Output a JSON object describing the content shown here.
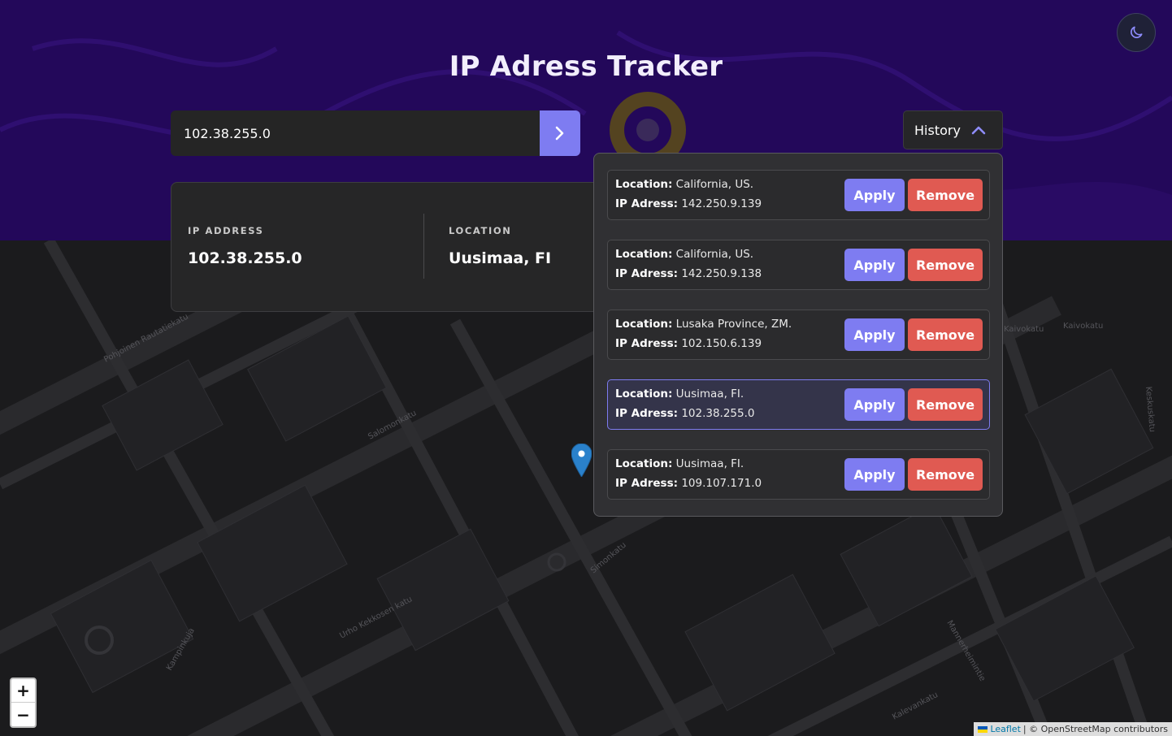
{
  "app": {
    "title": "IP Adress Tracker"
  },
  "search": {
    "value": "102.38.255.0"
  },
  "history_toggle": {
    "label": "History"
  },
  "info": {
    "ip_heading": "IP ADDRESS",
    "ip_value": "102.38.255.0",
    "location_heading": "LOCATION",
    "location_value": "Uusimaa, FI"
  },
  "history": {
    "location_label": "Location:",
    "ip_label": "IP Adress:",
    "apply_label": "Apply",
    "remove_label": "Remove",
    "entries": [
      {
        "location": "California, US.",
        "ip": "142.250.9.139",
        "active": false
      },
      {
        "location": "California, US.",
        "ip": "142.250.9.138",
        "active": false
      },
      {
        "location": "Lusaka Province, ZM.",
        "ip": "102.150.6.139",
        "active": false
      },
      {
        "location": "Uusimaa, FI.",
        "ip": "102.38.255.0",
        "active": true
      },
      {
        "location": "Uusimaa, FI.",
        "ip": "109.107.171.0",
        "active": false
      }
    ]
  },
  "map": {
    "zoom_in": "+",
    "zoom_out": "−",
    "attribution_link": "Leaflet",
    "attribution_text": "| © OpenStreetMap contributors",
    "street_labels": [
      "Pohjoinen Rautatiekatu",
      "Fredrikinkatu",
      "Salomonkatu",
      "Simonkatu",
      "Kampinkuja",
      "Urho Kekkosen katu",
      "Kaivokatu",
      "Mannerheimintie",
      "Keskuskatu",
      "Annankatu",
      "Kalevankatu",
      "Runeberginkatu",
      "Baana",
      "Narinkka",
      "Olavinkatu",
      "Yrjönkatu",
      "City-käytävä",
      "Arkadiankatu"
    ]
  },
  "colors": {
    "accent": "#7e7cf1",
    "danger": "#e05a52",
    "banner": "#23085a"
  },
  "icons": {
    "theme": "moon-icon",
    "search": "chevron-right-icon",
    "history": "chevron-up-icon",
    "marker": "map-marker-icon"
  }
}
